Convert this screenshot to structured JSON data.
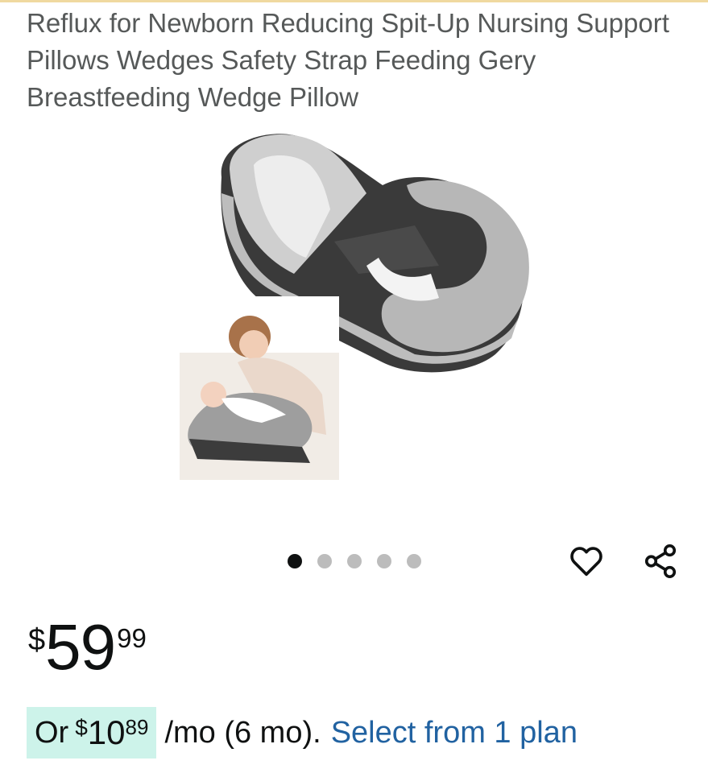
{
  "product": {
    "title": "Reflux for Newborn Reducing Spit-Up Nursing Support Pillows Wedges Safety Strap Feeding Gery Breastfeeding Wedge Pillow",
    "image": "product-photo-wedge-pillow",
    "inset_image": "mother-feeding-baby-photo"
  },
  "carousel": {
    "count": 5,
    "active_index": 0
  },
  "actions": {
    "wishlist_icon": "heart-icon",
    "share_icon": "share-icon"
  },
  "price": {
    "symbol": "$",
    "whole": "59",
    "fraction": "99"
  },
  "installment": {
    "prefix": "Or",
    "symbol": "$",
    "whole": "10",
    "fraction": "89",
    "terms": "/mo (6 mo).",
    "link": "Select from 1 plan"
  },
  "colors": {
    "link": "#2162a1",
    "installment_bg": "#cdf3ea",
    "title": "#565959"
  }
}
